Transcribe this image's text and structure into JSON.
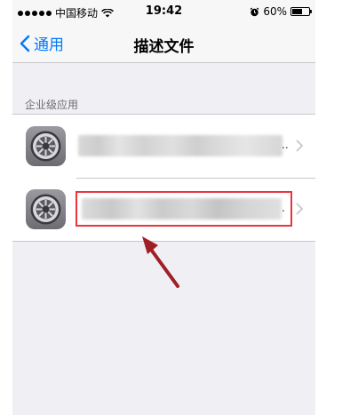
{
  "status_bar": {
    "carrier": "中国移动",
    "time": "19:42",
    "battery_percent": "60%",
    "battery_level": 0.6,
    "icons": [
      "signal-dots-icon",
      "wifi-icon",
      "alarm-icon",
      "battery-icon"
    ]
  },
  "nav": {
    "back_label": "通用",
    "title": "描述文件"
  },
  "section": {
    "header": "企业级应用"
  },
  "profiles": [
    {
      "icon": "settings-gear-icon",
      "ellipsis": ".."
    },
    {
      "icon": "settings-gear-icon",
      "ellipsis": "."
    }
  ],
  "annotation": {
    "highlight_color": "#e8363c",
    "arrow_color": "#a01f24"
  },
  "colors": {
    "accent": "#007aff",
    "background": "#efeff4"
  }
}
